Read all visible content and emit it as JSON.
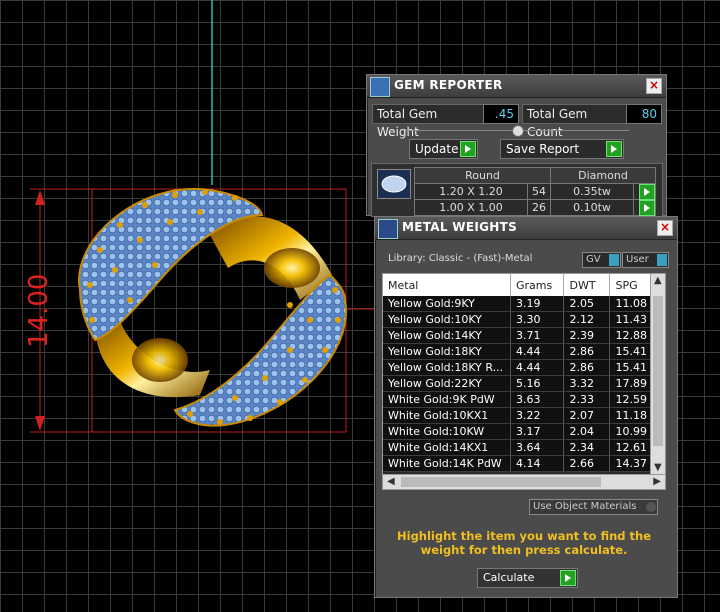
{
  "dimension_label": "14.00",
  "gem_reporter": {
    "title": "GEM REPORTER",
    "total_gem_weight_label": "Total Gem Weight",
    "total_gem_weight_value": ".45",
    "total_gem_count_label": "Total Gem Count",
    "total_gem_count_value": "80",
    "update_label": "Update",
    "save_report_label": "Save Report",
    "table": {
      "headers": [
        "Round",
        "Diamond"
      ],
      "rows": [
        {
          "size": "1.20 X 1.20",
          "count": "54",
          "weight": "0.35tw"
        },
        {
          "size": "1.00 X 1.00",
          "count": "26",
          "weight": "0.10tw"
        }
      ]
    }
  },
  "metal_weights": {
    "title": "METAL WEIGHTS",
    "library": "Library: Classic - (Fast)-Metal",
    "gv_label": "GV",
    "user_label": "User",
    "columns": [
      "Metal",
      "Grams",
      "DWT",
      "SPG"
    ],
    "rows": [
      [
        "Yellow Gold:9KY",
        "3.19",
        "2.05",
        "11.08"
      ],
      [
        "Yellow Gold:10KY",
        "3.30",
        "2.12",
        "11.43"
      ],
      [
        "Yellow Gold:14KY",
        "3.71",
        "2.39",
        "12.88"
      ],
      [
        "Yellow Gold:18KY",
        "4.44",
        "2.86",
        "15.41"
      ],
      [
        "Yellow Gold:18KY R...",
        "4.44",
        "2.86",
        "15.41"
      ],
      [
        "Yellow Gold:22KY",
        "5.16",
        "3.32",
        "17.89"
      ],
      [
        "White Gold:9K PdW",
        "3.63",
        "2.33",
        "12.59"
      ],
      [
        "White Gold:10KX1",
        "3.22",
        "2.07",
        "11.18"
      ],
      [
        "White Gold:10KW",
        "3.17",
        "2.04",
        "10.99"
      ],
      [
        "White Gold:14KX1",
        "3.64",
        "2.34",
        "12.61"
      ],
      [
        "White Gold:14K PdW",
        "4.14",
        "2.66",
        "14.37"
      ]
    ],
    "use_object_materials_label": "Use Object Materials",
    "hint": "Highlight the item you want to find the weight for then press calculate.",
    "calculate_label": "Calculate"
  }
}
